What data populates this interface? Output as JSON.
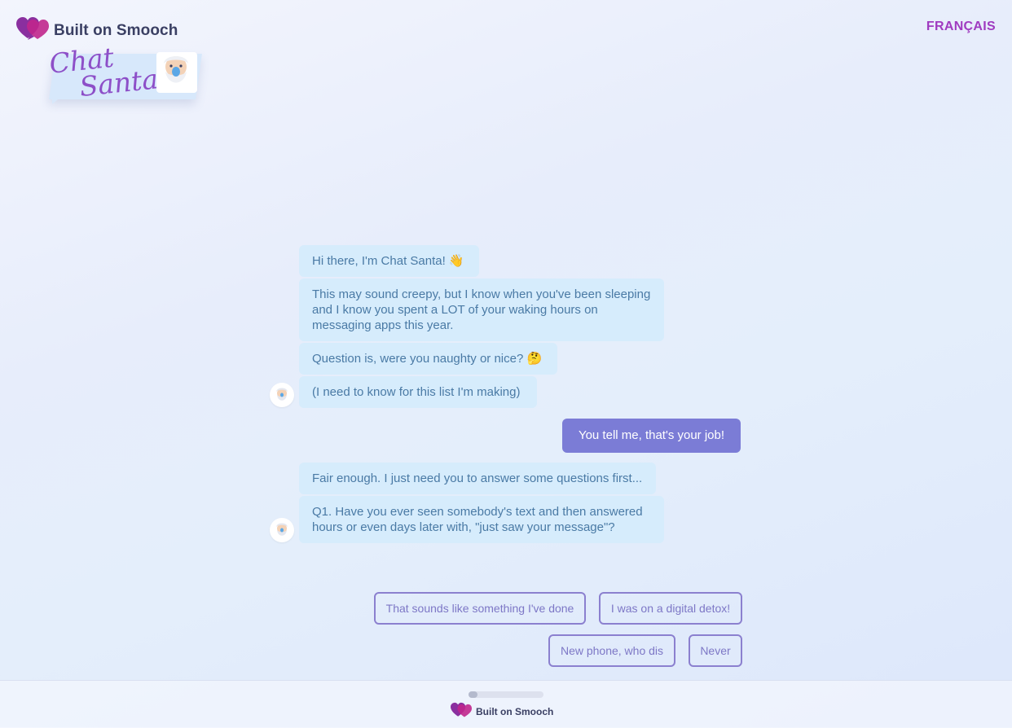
{
  "header": {
    "brand_label": "Built on Smooch",
    "language_link": "FRANÇAIS",
    "logo_text": [
      "Chat",
      "Santa"
    ]
  },
  "conversation": {
    "santa_group_1": [
      "Hi there, I'm Chat Santa! 👋",
      "This may sound creepy, but I know when you've been sleeping and I know you spent a LOT of your waking hours on messaging apps this year.",
      "Question is, were you naughty or nice? 🤔",
      "(I need to know for this list I'm making)"
    ],
    "user_message": "You tell me, that's your job!",
    "santa_group_2": [
      "Fair enough. I just need you to answer some questions first...",
      "Q1. Have you ever seen somebody's text and then answered hours or even days later with, \"just saw your message\"?"
    ]
  },
  "quick_replies": [
    "That sounds like something I've done",
    "I was on a digital detox!",
    "New phone, who dis",
    "Never"
  ],
  "footer": {
    "brand_label": "Built on Smooch",
    "progress_fraction": 0.12
  },
  "colors": {
    "accent": "#a03bc0",
    "santa_bubble": "#d6ecfc",
    "user_bubble": "#7b7cd6",
    "reply_border": "#8b80cf"
  },
  "icons": {
    "brand": "smooch-heart-icon",
    "avatar": "santa-avatar-icon"
  }
}
